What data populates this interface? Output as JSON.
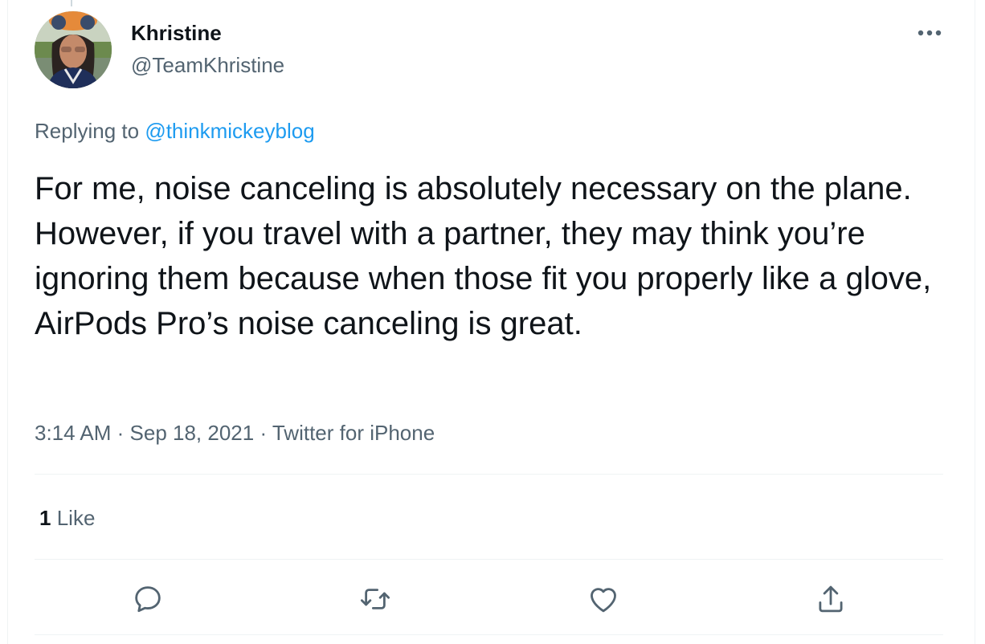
{
  "tweet": {
    "author": {
      "display_name": "Khristine",
      "handle": "@TeamKhristine",
      "avatar_icon": "profile-photo"
    },
    "more_icon": "more-horizontal-icon",
    "reply_context": {
      "prefix": "Replying to",
      "mention": "@thinkmickeyblog"
    },
    "text": "For me, noise canceling is absolutely necessary on the plane. However, if you travel with a partner, they may think you’re ignoring them because when those fit you properly like a glove, AirPods Pro’s noise canceling is great.",
    "timestamp": {
      "time": "3:14 AM",
      "separator1": " · ",
      "date": "Sep 18, 2021",
      "separator2": " · ",
      "source": "Twitter for iPhone"
    },
    "stats": {
      "like_count": "1",
      "like_label": "Like"
    },
    "actions": {
      "reply_icon": "reply-icon",
      "retweet_icon": "retweet-icon",
      "like_icon": "heart-icon",
      "share_icon": "share-icon"
    },
    "colors": {
      "text_primary": "#0f1419",
      "text_secondary": "#536471",
      "link": "#1d9bf0",
      "divider": "#eff3f4"
    }
  }
}
